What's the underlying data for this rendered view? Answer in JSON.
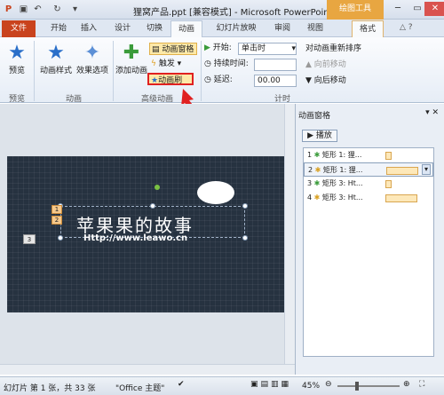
{
  "window": {
    "title": "狸窝产品.ppt [兼容模式] - Microsoft PowerPoint",
    "contextual_tab": "绘图工具"
  },
  "tabs": [
    "文件",
    "开始",
    "插入",
    "设计",
    "切换",
    "动画",
    "幻灯片放映",
    "审阅",
    "视图",
    "格式"
  ],
  "ribbon": {
    "preview": "预览",
    "anim_style": "动画样式",
    "effect_opts": "效果选项",
    "add_anim": "添加动画",
    "anim_pane": "动画窗格",
    "trigger": "触发 ▾",
    "anim_painter": "动画刷",
    "start_label": "开始:",
    "start_value": "单击时",
    "duration_label": "持续时间:",
    "duration_value": "",
    "delay_label": "延迟:",
    "delay_value": "00.00",
    "reorder": "对动画重新排序",
    "move_earlier": "向前移动",
    "move_later": "向后移动",
    "groups": {
      "preview": "预览",
      "animation": "动画",
      "advanced": "高级动画",
      "timing": "计时"
    }
  },
  "slide": {
    "title": "苹果果的故事",
    "url": "Http://www.leawo.cn",
    "badges": [
      "1",
      "2",
      "3"
    ]
  },
  "pane": {
    "title": "动画窗格",
    "play": "播放",
    "items": [
      {
        "num": "1",
        "text": "矩形 1: 狸...",
        "bar": 0.06
      },
      {
        "num": "2",
        "text": "矩形 1: 狸...",
        "bar": 0.35
      },
      {
        "num": "3",
        "text": "矩形 3: Ht...",
        "bar": 0.06
      },
      {
        "num": "4",
        "text": "矩形 3: Ht...",
        "bar": 0.35
      }
    ]
  },
  "status": {
    "slide": "幻灯片 第 1 张，共 33 张",
    "theme": "\"Office 主题\"",
    "zoom": "45%"
  },
  "colors": {
    "accent": "#c9431d",
    "highlight": "#e02020",
    "brand": "#2a6fc9"
  }
}
